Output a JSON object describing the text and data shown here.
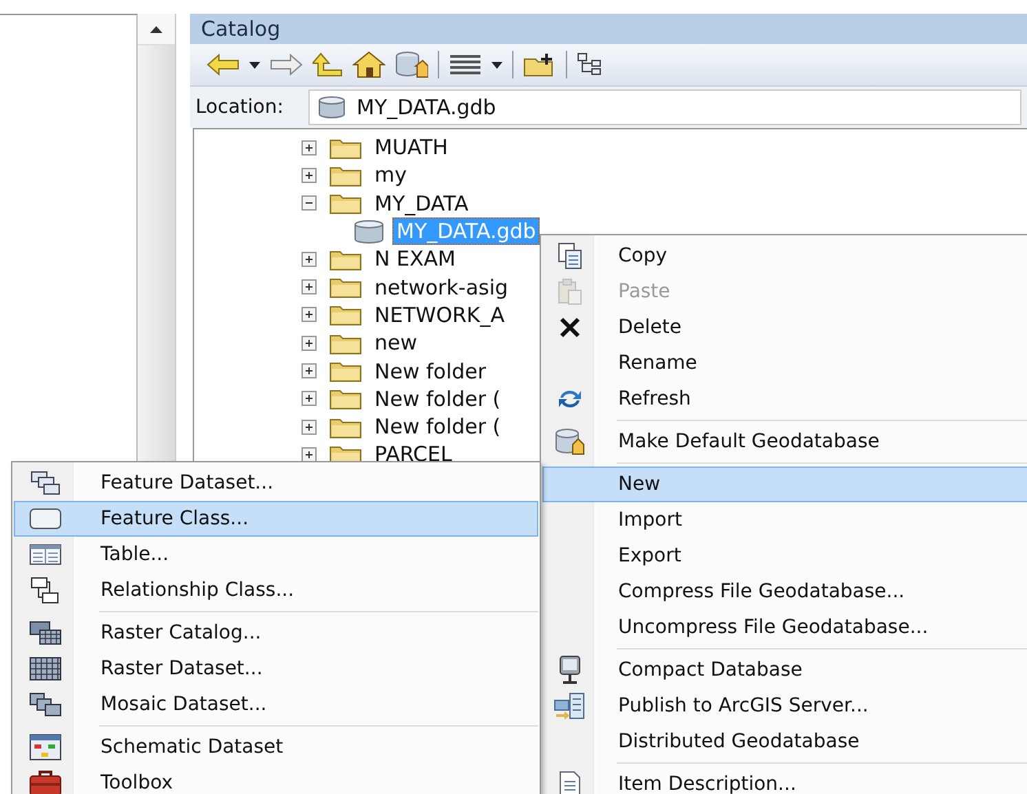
{
  "catalog": {
    "title": "Catalog",
    "location_label": "Location:",
    "location": "MY_DATA.gdb",
    "tree": [
      {
        "kind": "folder",
        "label": "MUATH",
        "expanded": false,
        "selected": false
      },
      {
        "kind": "folder",
        "label": "my",
        "expanded": false,
        "selected": false
      },
      {
        "kind": "folder",
        "label": "MY_DATA",
        "expanded": true,
        "selected": false,
        "children": [
          {
            "kind": "database",
            "label": "MY_DATA.gdb",
            "selected": true
          }
        ]
      },
      {
        "kind": "folder",
        "label": "N EXAM",
        "expanded": false,
        "selected": false
      },
      {
        "kind": "folder",
        "label": "network-asig",
        "expanded": false,
        "selected": false
      },
      {
        "kind": "folder",
        "label": "NETWORK_A",
        "expanded": false,
        "selected": false
      },
      {
        "kind": "folder",
        "label": "new",
        "expanded": false,
        "selected": false
      },
      {
        "kind": "folder",
        "label": "New folder",
        "expanded": false,
        "selected": false
      },
      {
        "kind": "folder",
        "label": "New folder (",
        "expanded": false,
        "selected": false
      },
      {
        "kind": "folder",
        "label": "New folder (",
        "expanded": false,
        "selected": false
      },
      {
        "kind": "folder",
        "label": "PARCEL",
        "expanded": false,
        "selected": false
      }
    ]
  },
  "context_menu": {
    "groups": [
      [
        {
          "label": "Copy",
          "disabled": false,
          "selected": false
        },
        {
          "label": "Paste",
          "disabled": true,
          "selected": false
        },
        {
          "label": "Delete",
          "disabled": false,
          "selected": false
        },
        {
          "label": "Rename",
          "disabled": false,
          "selected": false
        },
        {
          "label": "Refresh",
          "disabled": false,
          "selected": false
        }
      ],
      [
        {
          "label": "Make Default Geodatabase",
          "disabled": false,
          "selected": false
        }
      ],
      [
        {
          "label": "New",
          "disabled": false,
          "selected": true
        },
        {
          "label": "Import",
          "disabled": false,
          "selected": false
        },
        {
          "label": "Export",
          "disabled": false,
          "selected": false
        },
        {
          "label": "Compress File Geodatabase...",
          "disabled": false,
          "selected": false
        },
        {
          "label": "Uncompress File Geodatabase...",
          "disabled": false,
          "selected": false
        }
      ],
      [
        {
          "label": "Compact Database",
          "disabled": false,
          "selected": false
        },
        {
          "label": "Publish to ArcGIS Server...",
          "disabled": false,
          "selected": false
        },
        {
          "label": "Distributed Geodatabase",
          "disabled": false,
          "selected": false
        }
      ],
      [
        {
          "label": "Item Description...",
          "disabled": false,
          "selected": false
        }
      ]
    ]
  },
  "new_submenu": {
    "groups": [
      [
        {
          "label": "Feature Dataset...",
          "selected": false
        },
        {
          "label": "Feature Class...",
          "selected": true
        },
        {
          "label": "Table...",
          "selected": false
        },
        {
          "label": "Relationship Class...",
          "selected": false
        }
      ],
      [
        {
          "label": "Raster Catalog...",
          "selected": false
        },
        {
          "label": "Raster Dataset...",
          "selected": false
        },
        {
          "label": "Mosaic Dataset...",
          "selected": false
        }
      ],
      [
        {
          "label": "Schematic Dataset",
          "selected": false
        },
        {
          "label": "Toolbox",
          "selected": false
        }
      ]
    ]
  }
}
